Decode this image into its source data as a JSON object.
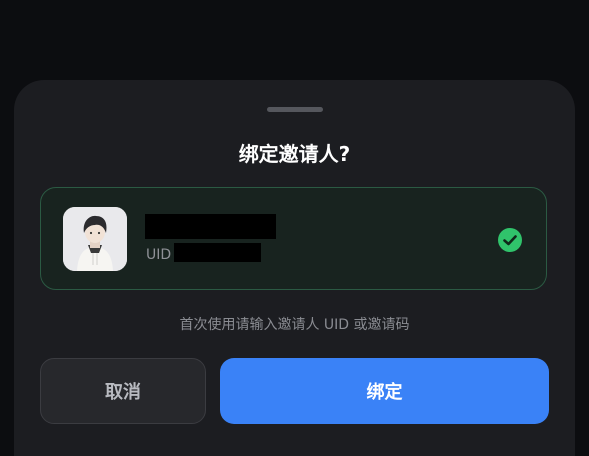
{
  "dialog": {
    "title": "绑定邀请人?",
    "inviter": {
      "uid_label": "UID",
      "selected": true
    },
    "hint": "首次使用请输入邀请人 UID 或邀请码",
    "cancel_label": "取消",
    "confirm_label": "绑定"
  },
  "colors": {
    "accent": "#3a82f7",
    "success": "#30c36b"
  }
}
